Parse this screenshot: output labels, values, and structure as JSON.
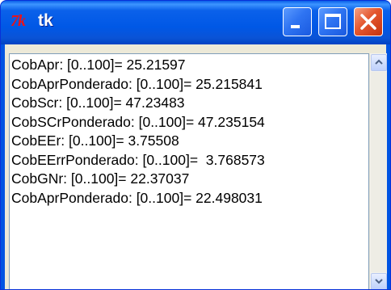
{
  "window": {
    "title": "tk",
    "app_icon_text": "7k",
    "buttons": [
      "minimize",
      "maximize",
      "close"
    ]
  },
  "text_area": {
    "lines": [
      "CobApr: [0..100]= 25.21597",
      "CobAprPonderado: [0..100]= 25.215841",
      "CobScr: [0..100]= 47.23483",
      "CobSCrPonderado: [0..100]= 47.235154",
      "CobEEr: [0..100]= 3.75508",
      "CobEErrPonderado: [0..100]=  3.768573",
      "CobGNr: [0..100]= 22.37037",
      "CobAprPonderado: [0..100]= 22.498031"
    ]
  },
  "colors": {
    "titlebar": "#0058e6",
    "close_button": "#e4572e",
    "window_face": "#ece9d8",
    "tk_logo": "#e8141b"
  },
  "icons": {
    "app": "tk-feather-icon",
    "minimize": "minimize-icon",
    "maximize": "maximize-icon",
    "close": "close-icon",
    "scroll_up": "chevron-up-icon",
    "scroll_down": "chevron-down-icon"
  }
}
